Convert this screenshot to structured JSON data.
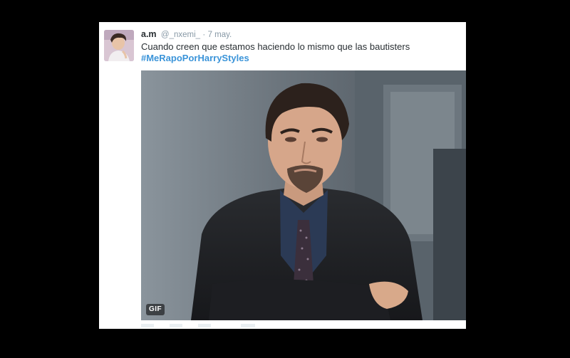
{
  "tweet": {
    "display_name": "a.m",
    "handle": "@_nxemi_",
    "separator": "·",
    "date": "7 may.",
    "text": "Cuando creen que estamos haciendo lo mismo que las bautisters",
    "hashtag": "#MeRapoPorHarryStyles",
    "media": {
      "badge": "GIF",
      "icon": "gif-badge"
    }
  },
  "colors": {
    "background": "#000000",
    "card": "#ffffff",
    "name": "#292f33",
    "meta": "#8899a6",
    "hashtag": "#3b94d9"
  }
}
